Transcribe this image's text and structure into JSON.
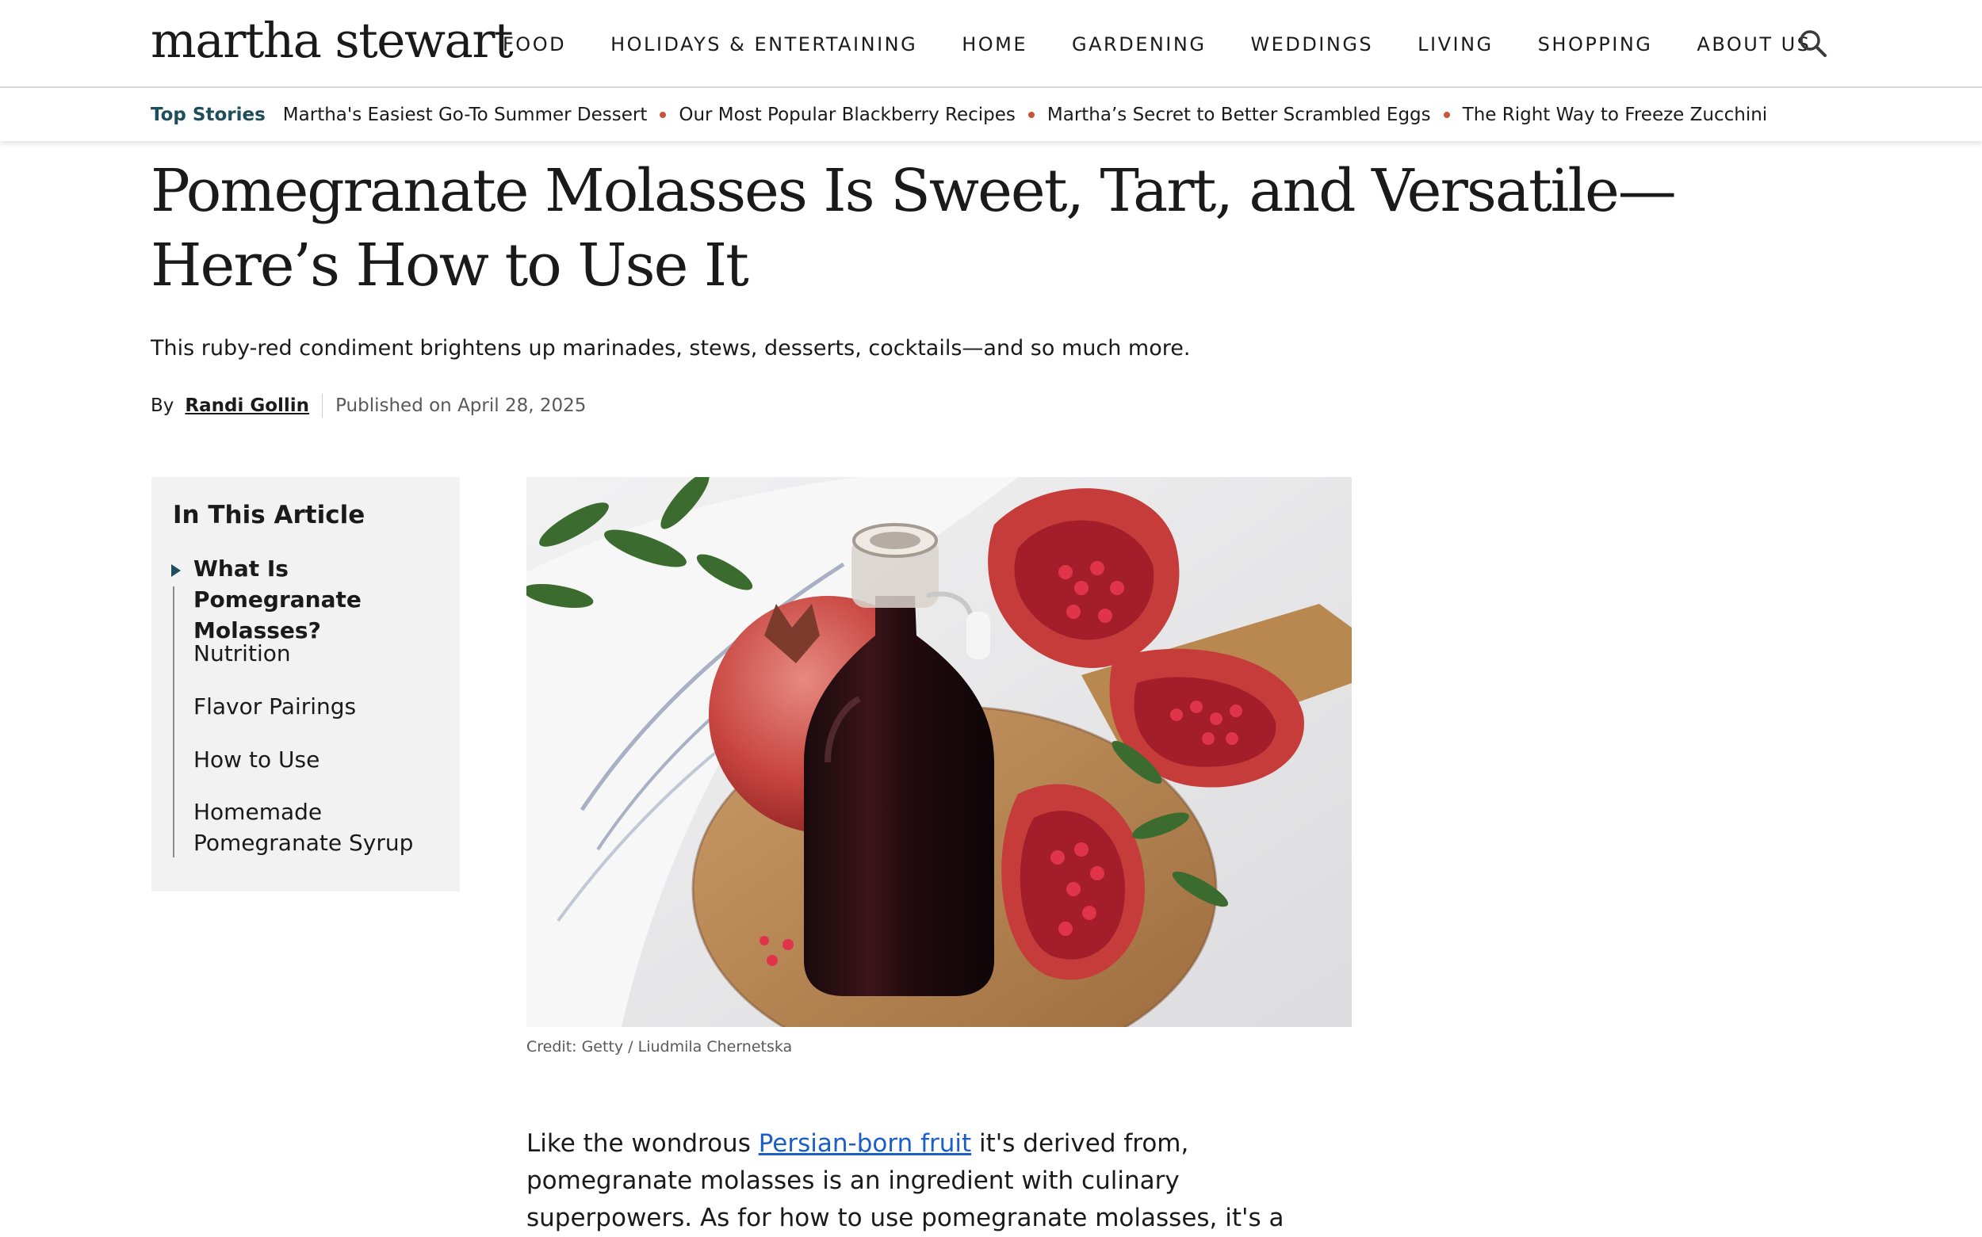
{
  "header": {
    "logo": "martha stewart",
    "nav": [
      "FOOD",
      "HOLIDAYS & ENTERTAINING",
      "HOME",
      "GARDENING",
      "WEDDINGS",
      "LIVING",
      "SHOPPING",
      "ABOUT US"
    ],
    "search_icon": "search-icon"
  },
  "top_stories": {
    "label": "Top Stories",
    "links": [
      "Martha's Easiest Go-To Summer Dessert",
      "Our Most Popular Blackberry Recipes",
      "Martha’s Secret to Better Scrambled Eggs",
      "The Right Way to Freeze Zucchini"
    ]
  },
  "article": {
    "headline": "Pomegranate Molasses Is Sweet, Tart, and Versatile—Here’s How to Use It",
    "dek": "This ruby-red condiment brightens up marinades, stews, desserts, cocktails—and so much more.",
    "byline": {
      "by": "By",
      "author": "Randi Gollin",
      "published": "Published on April 28, 2025"
    },
    "toc": {
      "title": "In This Article",
      "items": [
        "What Is Pomegranate Molasses?",
        "Nutrition",
        "Flavor Pairings",
        "How to Use",
        "Homemade Pomegranate Syrup"
      ]
    },
    "image_credit": "Credit: Getty / Liudmila Chernetska",
    "body": {
      "before_link": "Like the wondrous ",
      "link": "Persian-born fruit",
      "after_link": " it's derived from, pomegranate molasses is an ingredient with culinary superpowers. As for how to use pomegranate molasses, it's a game changer that goes the gamut,"
    }
  },
  "colors": {
    "accent_teal": "#1e4d5c",
    "dot_orange": "#c9543a",
    "link_blue": "#1b5ec7"
  }
}
